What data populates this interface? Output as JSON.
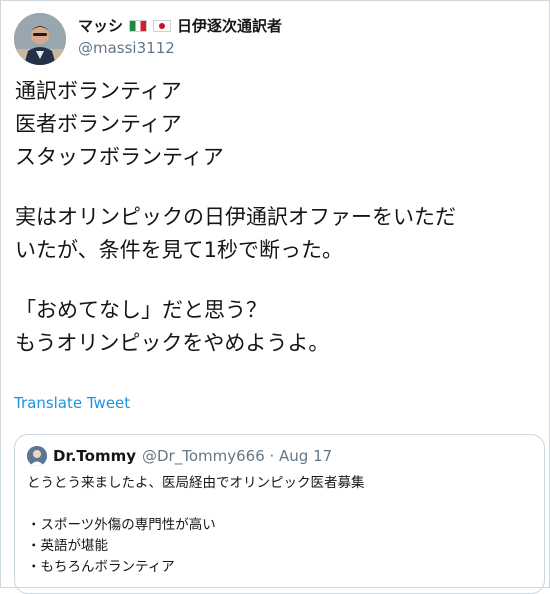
{
  "author": {
    "display_name": "マッシ",
    "title": "日伊逐次通訳者",
    "handle": "@massi3112"
  },
  "tweet": {
    "lines_a": [
      "通訳ボランティア",
      "医者ボランティア",
      "スタッフボランティア"
    ],
    "lines_b": [
      "実はオリンピックの日伊通訳オファーをいただ",
      "いたが、条件を見て1秒で断った。"
    ],
    "lines_c": [
      "「おめてなし」だと思う？",
      "もうオリンピックをやめようよ。"
    ]
  },
  "translate_label": "Translate Tweet",
  "quoted": {
    "display_name": "Dr.Tommy",
    "handle_date": "@Dr_Tommy666 · Aug 17",
    "line1": "とうとう来ましたよ、医局経由でオリンピック医者募集",
    "bullets": [
      "・スポーツ外傷の専門性が高い",
      "・英語が堪能",
      "・もちろんボランティア"
    ]
  }
}
